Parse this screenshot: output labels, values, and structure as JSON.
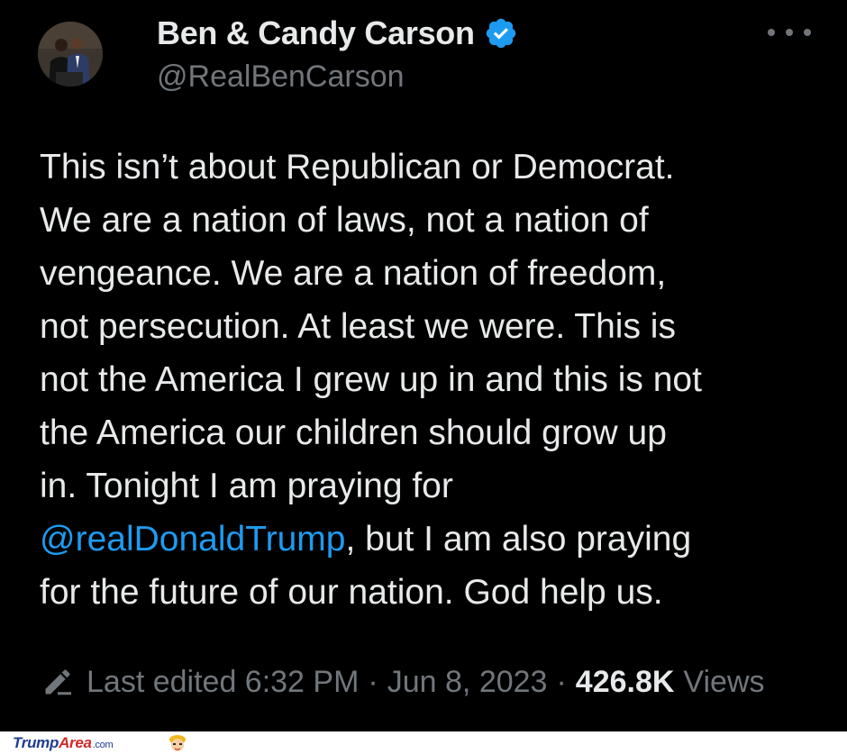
{
  "author": {
    "display_name": "Ben & Candy Carson",
    "handle": "@RealBenCarson",
    "verified": true,
    "avatar_icon": "profile-photo-avatar"
  },
  "tweet": {
    "text_part1": "This isn’t about Republican or Democrat.\nWe are a nation of laws, not a nation of\nvengeance. We are a nation of freedom,\nnot persecution. At least we were. This is\nnot the America I grew up in and this is not\nthe America our children should grow up\nin. Tonight I am praying for\n",
    "mention": "@realDonaldTrump",
    "text_part2": ", but I am also praying\nfor the future of our nation. God help us."
  },
  "meta": {
    "edited_label": "Last edited 6:32 PM",
    "separator": "·",
    "date": "Jun 8, 2023",
    "views_count": "426.8K",
    "views_label": "Views"
  },
  "footer": {
    "brand_part1": "Trump",
    "brand_part2": "Area",
    "brand_part3": ".com"
  },
  "colors": {
    "background": "#000000",
    "text": "#e7e9ea",
    "secondary": "#71767b",
    "link": "#1d9bf0"
  }
}
